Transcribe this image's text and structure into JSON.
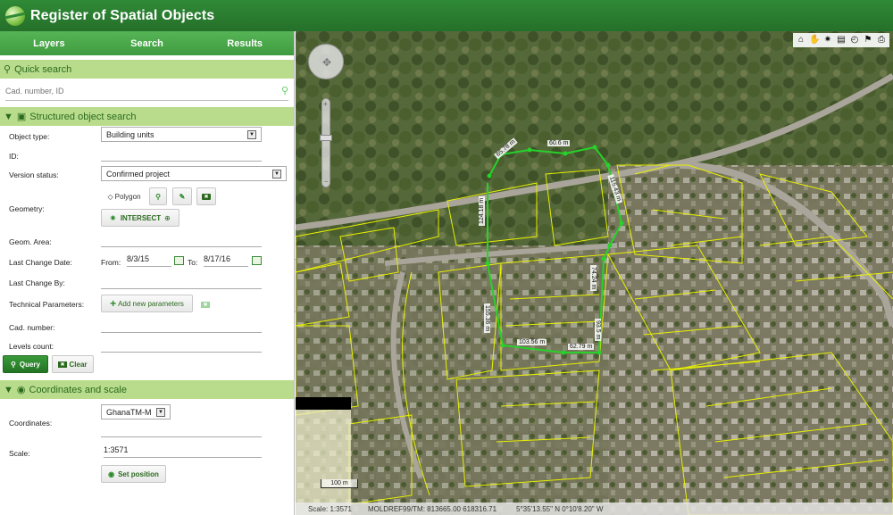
{
  "app": {
    "title": "Register of Spatial Objects"
  },
  "tabs": [
    {
      "label": "Layers"
    },
    {
      "label": "Search"
    },
    {
      "label": "Results"
    }
  ],
  "quick_search": {
    "title": "Quick search",
    "placeholder": "Cad. number, ID"
  },
  "structured": {
    "title": "Structured object search",
    "object_type_label": "Object type:",
    "object_type_value": "Building units",
    "id_label": "ID:",
    "version_status_label": "Version status:",
    "version_status_value": "Confirmed project",
    "geometry_label": "Geometry:",
    "polygon_label": "Polygon",
    "intersect_label": "INTERSECT",
    "geom_area_label": "Geom. Area:",
    "last_change_date_label": "Last Change Date:",
    "from_label": "From:",
    "from_value": "8/3/15",
    "to_label": "To:",
    "to_value": "8/17/16",
    "last_change_by_label": "Last Change By:",
    "tech_params_label": "Technical Parameters:",
    "add_params_label": "Add new parameters",
    "cad_number_label": "Cad. number:",
    "levels_count_label": "Levels count:",
    "query_label": "Query",
    "clear_label": "Clear"
  },
  "coords": {
    "title": "Coordinates and scale",
    "coordinates_label": "Coordinates:",
    "crs_value": "GhanaTM-M",
    "scale_label": "Scale:",
    "scale_value": "1:3571",
    "set_position_label": "Set position"
  },
  "map": {
    "measurements": [
      "60.6 m",
      "65.78 m",
      "115.43 m",
      "124.18 m",
      "155.36 m",
      "74.24 m",
      "93.5 m",
      "103.56 m",
      "62.79 m"
    ],
    "scalebar_label": "100 m",
    "status": {
      "scale": "Scale: 1:3571",
      "projected": "MOLDREF99/TM: 813665.00 618316.71",
      "geographic": "5°35'13.55\" N 0°10'8.20\" W"
    }
  },
  "colors": {
    "header": "#2e7d32",
    "tab_bar": "#4aa84a",
    "section": "#b8dc8c",
    "parcel": "#e8f000",
    "selection": "#27d22a"
  },
  "icons": [
    "home-icon",
    "pan-icon",
    "person-icon",
    "document-icon",
    "clock-icon",
    "flag-icon",
    "print-icon"
  ]
}
